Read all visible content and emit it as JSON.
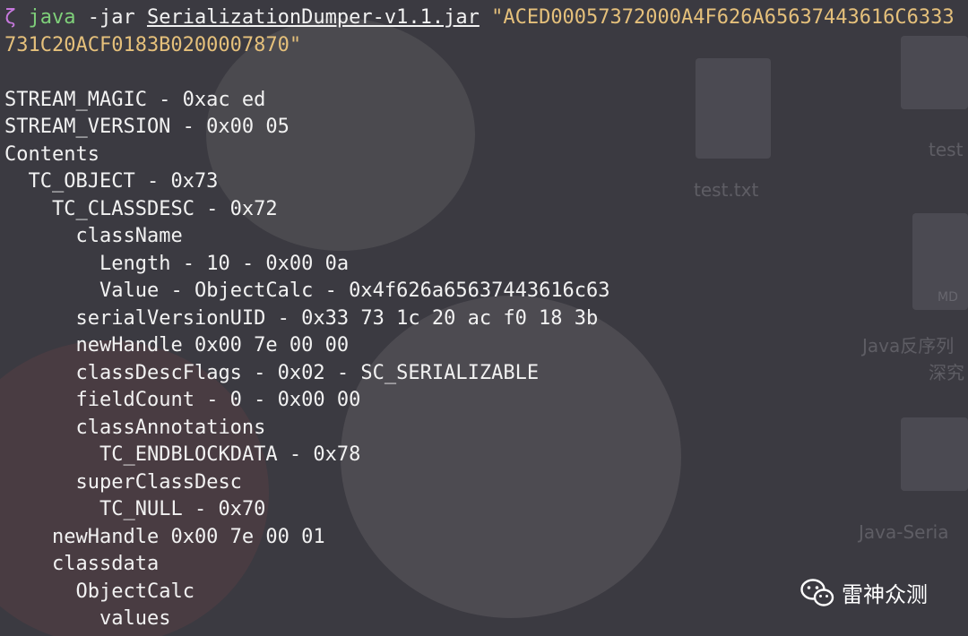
{
  "terminal": {
    "prompt": "ζ",
    "command": "java",
    "args": " -jar ",
    "jar": "SerializationDumper-v1.1.jar",
    "hex_part1": " \"ACED00057372000A4F626A65637443616C6333",
    "hex_part2": "731C20ACF0183B0200007870\"",
    "output": [
      {
        "indent": 0,
        "text": "STREAM_MAGIC - 0xac ed"
      },
      {
        "indent": 0,
        "text": "STREAM_VERSION - 0x00 05"
      },
      {
        "indent": 0,
        "text": "Contents"
      },
      {
        "indent": 1,
        "text": "TC_OBJECT - 0x73"
      },
      {
        "indent": 2,
        "text": "TC_CLASSDESC - 0x72"
      },
      {
        "indent": 3,
        "text": "className"
      },
      {
        "indent": 4,
        "text": "Length - 10 - 0x00 0a"
      },
      {
        "indent": 4,
        "text": "Value - ObjectCalc - 0x4f626a65637443616c63"
      },
      {
        "indent": 3,
        "text": "serialVersionUID - 0x33 73 1c 20 ac f0 18 3b"
      },
      {
        "indent": 3,
        "text": "newHandle 0x00 7e 00 00"
      },
      {
        "indent": 3,
        "text": "classDescFlags - 0x02 - SC_SERIALIZABLE"
      },
      {
        "indent": 3,
        "text": "fieldCount - 0 - 0x00 00"
      },
      {
        "indent": 3,
        "text": "classAnnotations"
      },
      {
        "indent": 4,
        "text": "TC_ENDBLOCKDATA - 0x78"
      },
      {
        "indent": 3,
        "text": "superClassDesc"
      },
      {
        "indent": 4,
        "text": "TC_NULL - 0x70"
      },
      {
        "indent": 2,
        "text": "newHandle 0x00 7e 00 01"
      },
      {
        "indent": 2,
        "text": "classdata"
      },
      {
        "indent": 3,
        "text": "ObjectCalc"
      },
      {
        "indent": 4,
        "text": "values"
      }
    ]
  },
  "desktop": {
    "file_label": "test.txt",
    "file_badge": "MD",
    "file_label_2": "Java反序列",
    "file_label_3": "深究",
    "file_label_4": "Java-Seria",
    "file_label_5": "test"
  },
  "watermark": {
    "text": "雷神众测",
    "icon": "wechat-icon"
  },
  "colors": {
    "prompt": "#c678dd",
    "command": "#7fd07a",
    "string": "#e5c07b",
    "text": "#f2f2f2",
    "background": "#3b3a41"
  }
}
